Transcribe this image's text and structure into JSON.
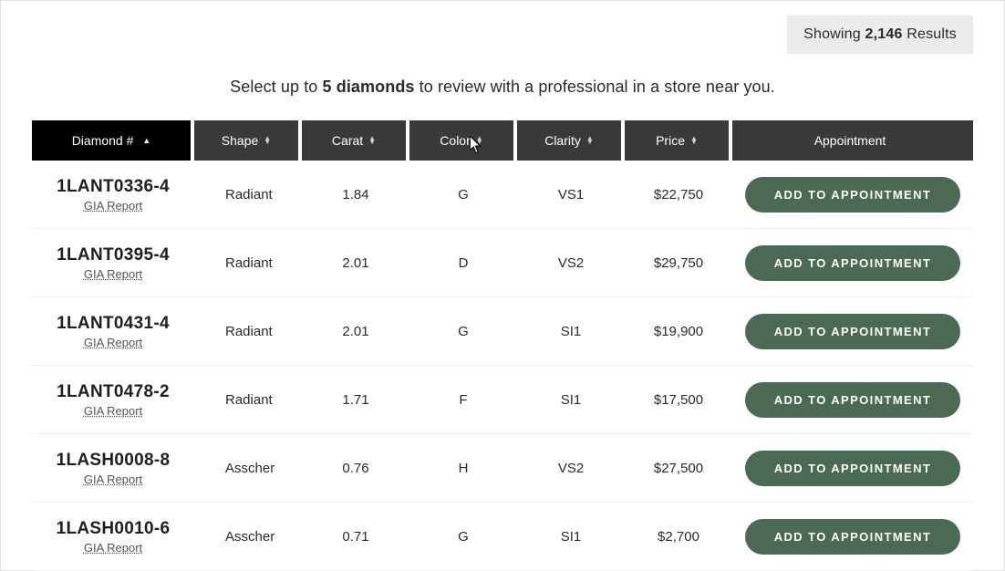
{
  "results": {
    "prefix": "Showing",
    "count": "2,146",
    "suffix": "Results"
  },
  "instruction": {
    "pre": "Select up to ",
    "bold": "5 diamonds",
    "post": " to review with a professional in a store near you."
  },
  "headers": {
    "diamond": "Diamond #",
    "shape": "Shape",
    "carat": "Carat",
    "color": "Color",
    "clarity": "Clarity",
    "price": "Price",
    "appointment": "Appointment"
  },
  "gia_label": "GIA Report",
  "button_label": "ADD TO APPOINTMENT",
  "rows": [
    {
      "id": "1LANT0336-4",
      "shape": "Radiant",
      "carat": "1.84",
      "color": "G",
      "clarity": "VS1",
      "price": "$22,750"
    },
    {
      "id": "1LANT0395-4",
      "shape": "Radiant",
      "carat": "2.01",
      "color": "D",
      "clarity": "VS2",
      "price": "$29,750"
    },
    {
      "id": "1LANT0431-4",
      "shape": "Radiant",
      "carat": "2.01",
      "color": "G",
      "clarity": "SI1",
      "price": "$19,900"
    },
    {
      "id": "1LANT0478-2",
      "shape": "Radiant",
      "carat": "1.71",
      "color": "F",
      "clarity": "SI1",
      "price": "$17,500"
    },
    {
      "id": "1LASH0008-8",
      "shape": "Asscher",
      "carat": "0.76",
      "color": "H",
      "clarity": "VS2",
      "price": "$27,500"
    },
    {
      "id": "1LASH0010-6",
      "shape": "Asscher",
      "carat": "0.71",
      "color": "G",
      "clarity": "SI1",
      "price": "$2,700"
    }
  ]
}
